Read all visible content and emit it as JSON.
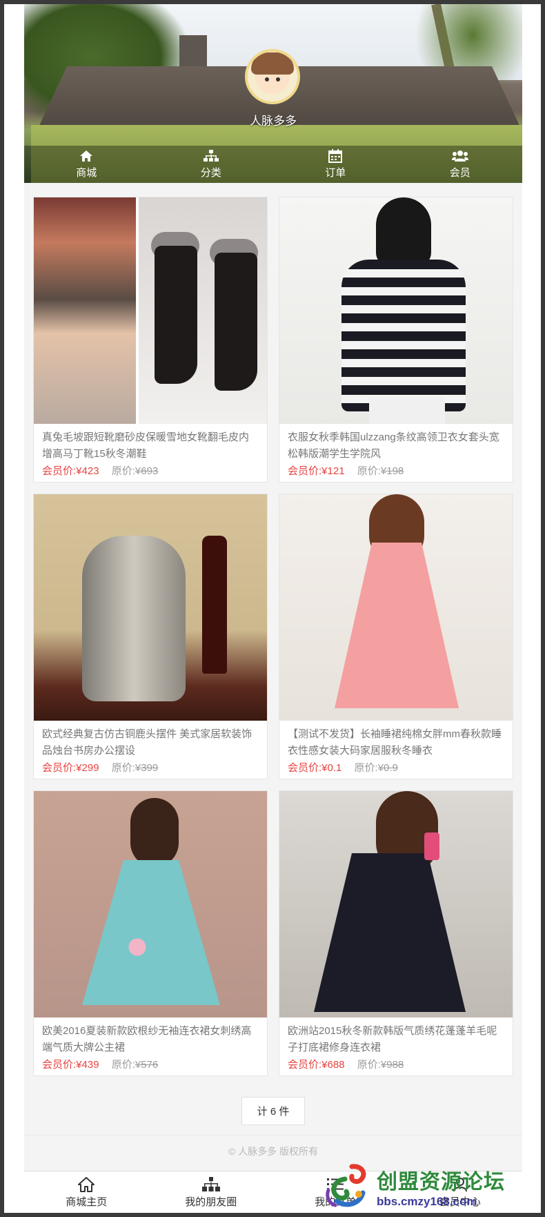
{
  "header": {
    "site_name": "人脉多多",
    "nav": [
      {
        "label": "商城",
        "icon": "home-icon"
      },
      {
        "label": "分类",
        "icon": "sitemap-icon"
      },
      {
        "label": "订单",
        "icon": "calendar-icon"
      },
      {
        "label": "会员",
        "icon": "users-icon"
      }
    ]
  },
  "products": [
    {
      "title": "真兔毛坡跟短靴磨砂皮保暖雪地女靴翻毛皮内增高马丁靴15秋冬潮鞋",
      "member_label": "会员价:",
      "member_price": "¥423",
      "orig_label": "原价:",
      "orig_price": "¥693"
    },
    {
      "title": "衣服女秋季韩国ulzzang条纹高领卫衣女套头宽松韩版潮学生学院风",
      "member_label": "会员价:",
      "member_price": "¥121",
      "orig_label": "原价:",
      "orig_price": "¥198"
    },
    {
      "title": "欧式经典复古仿古铜鹿头摆件 美式家居软装饰品烛台书房办公摆设",
      "member_label": "会员价:",
      "member_price": "¥299",
      "orig_label": "原价:",
      "orig_price": "¥399"
    },
    {
      "title": "【测试不发货】长袖睡裙纯棉女胖mm春秋款睡衣性感女装大码家居服秋冬睡衣",
      "member_label": "会员价:",
      "member_price": "¥0.1",
      "orig_label": "原价:",
      "orig_price": "¥0.9"
    },
    {
      "title": "欧美2016夏装新款欧根纱无袖连衣裙女刺绣高端气质大牌公主裙",
      "member_label": "会员价:",
      "member_price": "¥439",
      "orig_label": "原价:",
      "orig_price": "¥576"
    },
    {
      "title": "欧洲站2015秋冬新款韩版气质绣花蓬蓬羊毛呢子打底裙修身连衣裙",
      "member_label": "会员价:",
      "member_price": "¥688",
      "orig_label": "原价:",
      "orig_price": "¥988"
    }
  ],
  "total_count": "计 6 件",
  "copyright": "© 人脉多多 版权所有",
  "bottom_nav": [
    {
      "label": "商城主页",
      "icon": "home-outline-icon"
    },
    {
      "label": "我的朋友圈",
      "icon": "sitemap-icon"
    },
    {
      "label": "我的订单",
      "icon": "list-icon"
    },
    {
      "label": "会员中心",
      "icon": "user-icon"
    }
  ],
  "watermark": {
    "title": "创盟资源论坛",
    "url": "bbs.cmzy168.com"
  },
  "colors": {
    "member_price": "#e64340",
    "original_price": "#9a9a9a",
    "background": "#f4f4f4"
  }
}
